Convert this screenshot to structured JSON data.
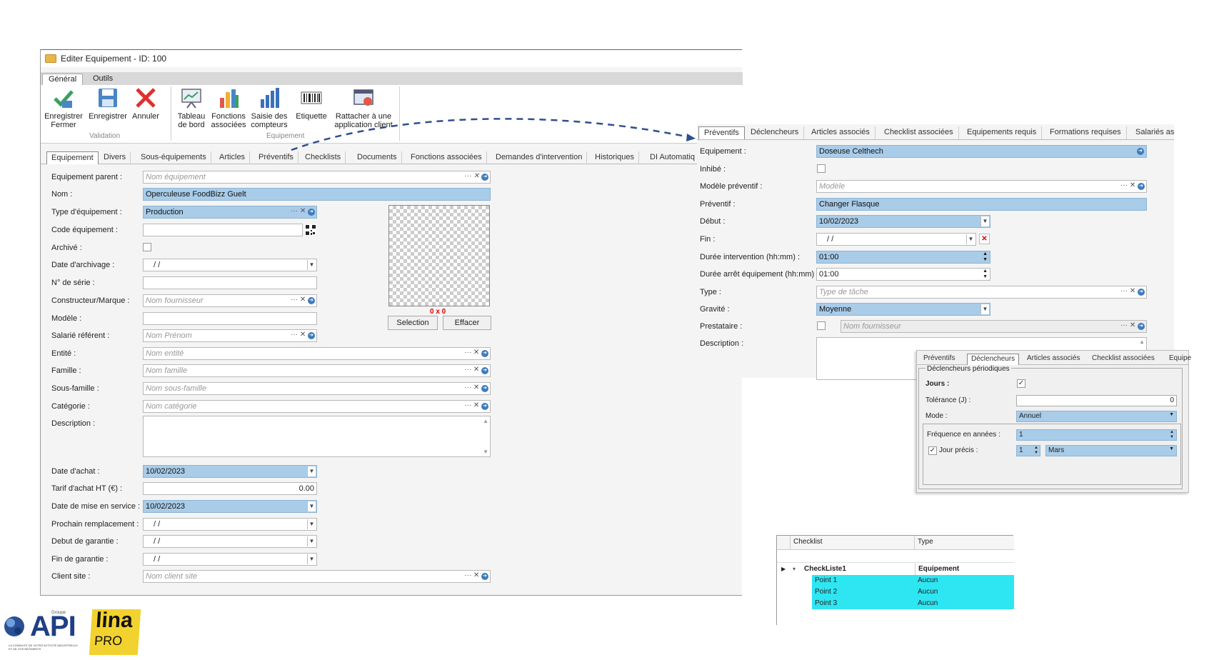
{
  "window": {
    "title": "Editer Equipement - ID: 100"
  },
  "ribbon": {
    "tabs": [
      "Général",
      "Outils"
    ],
    "buttons": {
      "save_close": "Enregistrer\nFermer",
      "save": "Enregistrer",
      "cancel": "Annuler",
      "dashboard": "Tableau\nde bord",
      "functions": "Fonctions\nassociées",
      "counters": "Saisie des\ncompteurs",
      "label": "Etiquette",
      "attach": "Rattacher à une\napplication client"
    },
    "groups": {
      "validation": "Validation",
      "equipement": "Equipement"
    }
  },
  "main_tabs": [
    "Equipement",
    "Divers",
    "Sous-équipements",
    "Articles",
    "Préventifs",
    "Checklists",
    "Documents",
    "Fonctions associées",
    "Demandes d'intervention",
    "Historiques",
    "DI Automatiq"
  ],
  "form": {
    "parent": {
      "label": "Equipement parent :",
      "placeholder": "Nom équipement"
    },
    "name": {
      "label": "Nom :",
      "value": "Operculeuse FoodBizz Guelt"
    },
    "type": {
      "label": "Type d'équipement :",
      "value": "Production"
    },
    "code": {
      "label": "Code équipement :",
      "value": ""
    },
    "archived": {
      "label": "Archivé :"
    },
    "archive_date": {
      "label": "Date d'archivage :",
      "value": " /   /"
    },
    "serial": {
      "label": "N° de série :",
      "value": ""
    },
    "maker": {
      "label": "Constructeur/Marque :",
      "placeholder": "Nom fournisseur"
    },
    "model": {
      "label": "Modèle :",
      "value": ""
    },
    "employee": {
      "label": "Salarié référent :",
      "placeholder": "Nom Prénom"
    },
    "entity": {
      "label": "Entité :",
      "placeholder": "Nom entité"
    },
    "family": {
      "label": "Famille :",
      "placeholder": "Nom famille"
    },
    "subfamily": {
      "label": "Sous-famille :",
      "placeholder": "Nom sous-famille"
    },
    "category": {
      "label": "Catégorie :",
      "placeholder": "Nom catégorie"
    },
    "description": {
      "label": "Description :"
    },
    "purchase_date": {
      "label": "Date d'achat :",
      "value": "10/02/2023"
    },
    "price": {
      "label": "Tarif d'achat HT (€) :",
      "value": "0.00"
    },
    "service_date": {
      "label": "Date de mise en service :",
      "value": "10/02/2023"
    },
    "next_replace": {
      "label": "Prochain remplacement :",
      "value": " /   /"
    },
    "warranty_start": {
      "label": "Debut de garantie :",
      "value": " /   /"
    },
    "warranty_end": {
      "label": "Fin de garantie :",
      "value": " /   /"
    },
    "client_site": {
      "label": "Client site :",
      "placeholder": "Nom client site"
    },
    "image": {
      "size": "0 x 0",
      "select": "Selection",
      "clear": "Effacer"
    }
  },
  "preventif": {
    "tabs": [
      "Préventifs",
      "Déclencheurs",
      "Articles associés",
      "Checklist associées",
      "Equipements requis",
      "Formations requises",
      "Salariés as"
    ],
    "equipement": {
      "label": "Equipement :",
      "value": "Doseuse Celthech"
    },
    "inhibe": {
      "label": "Inhibé :"
    },
    "modele": {
      "label": "Modèle préventif :",
      "placeholder": "Modèle"
    },
    "preventif": {
      "label": "Préventif :",
      "value": "Changer Flasque"
    },
    "debut": {
      "label": "Début :",
      "value": "10/02/2023"
    },
    "fin": {
      "label": "Fin :",
      "value": " /   /"
    },
    "duree_int": {
      "label": "Durée intervention (hh:mm) :",
      "value": "01:00"
    },
    "duree_arret": {
      "label": "Durée arrêt équipement (hh:mm) :",
      "value": "01:00"
    },
    "type": {
      "label": "Type :",
      "placeholder": "Type de tâche"
    },
    "gravite": {
      "label": "Gravité :",
      "value": "Moyenne"
    },
    "prestataire": {
      "label": "Prestataire :",
      "placeholder": "Nom fournisseur"
    },
    "description": {
      "label": "Description :"
    }
  },
  "declencheurs": {
    "tabs": [
      "Préventifs",
      "Déclencheurs",
      "Articles associés",
      "Checklist associées",
      "Equipe"
    ],
    "group": "Déclencheurs périodiques",
    "jours": "Jours :",
    "tolerance": {
      "label": "Tolérance (J) :",
      "value": "0"
    },
    "mode": {
      "label": "Mode :",
      "value": "Annuel"
    },
    "frequence": {
      "label": "Fréquence en années :",
      "value": "1"
    },
    "jour_precis": {
      "label": "Jour précis :",
      "day": "1",
      "month": "Mars"
    }
  },
  "checklist": {
    "columns": [
      "Checklist",
      "Type"
    ],
    "parent": {
      "name": "CheckListe1",
      "type": "Equipement"
    },
    "rows": [
      {
        "name": "Point 1",
        "type": "Aucun"
      },
      {
        "name": "Point 2",
        "type": "Aucun"
      },
      {
        "name": "Point 3",
        "type": "Aucun"
      }
    ]
  },
  "logos": {
    "api": "API",
    "api_small": "Groupe",
    "api_tagline": "LA CONDUITE DE VOTRE ACTIVITÉ INDUSTRIELLE ET DE VOS BÂTIMENTS",
    "lina": "lina",
    "pro": "PRO"
  },
  "colors": {
    "field_blue": "#a9cce8",
    "cyan_row": "#2ee6f2",
    "accent_blue": "#3f7bbd"
  }
}
